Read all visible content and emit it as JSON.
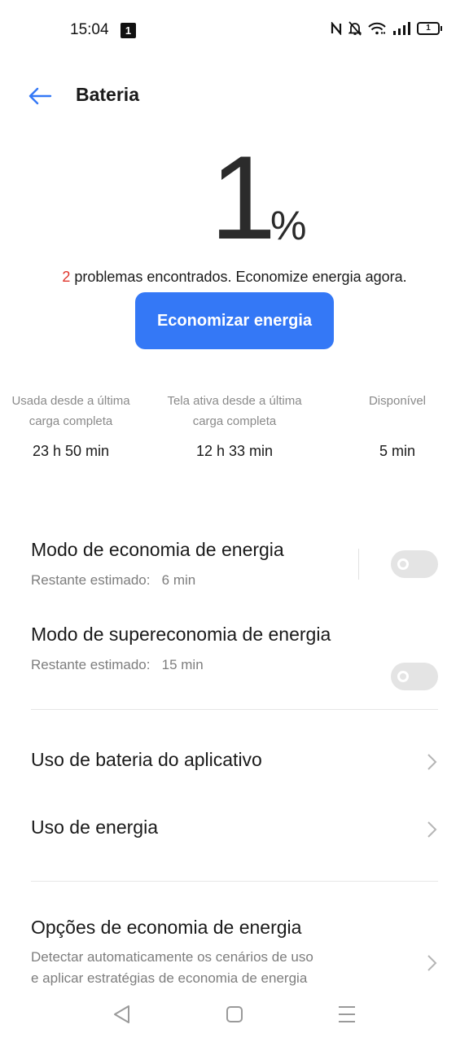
{
  "status_bar": {
    "time": "15:04",
    "notification_badge": "1",
    "icons": [
      "nfc-icon",
      "bell-off-icon",
      "wifi-icon",
      "signal-icon",
      "battery-icon"
    ],
    "battery_level": "1"
  },
  "header": {
    "title": "Bateria",
    "back_icon": "arrow-left-icon"
  },
  "battery": {
    "percent_value": "1",
    "percent_sign": "%"
  },
  "problems": {
    "count": "2",
    "text": " problemas encontrados. Economize energia agora."
  },
  "save_button": {
    "label": "Economizar energia"
  },
  "stats": [
    {
      "label_line1": "Usada desde a última",
      "label_line2": "carga completa",
      "value": "23 h 50 min"
    },
    {
      "label_line1": "Tela ativa desde a última",
      "label_line2": "carga completa",
      "value": "12 h 33 min"
    },
    {
      "label_line1": "Disponível",
      "label_line2": "",
      "value": "5 min"
    }
  ],
  "modes": [
    {
      "title": "Modo de economia de energia",
      "subtitle_label": "Restante estimado:",
      "subtitle_value": "6 min",
      "enabled": false
    },
    {
      "title": "Modo de supereconomia de energia",
      "subtitle_label": "Restante estimado:",
      "subtitle_value": "15 min",
      "enabled": false
    }
  ],
  "links": [
    {
      "title": "Uso de bateria do aplicativo"
    },
    {
      "title": "Uso de energia"
    }
  ],
  "options": {
    "title": "Opções de economia de energia",
    "description_line1": "Detectar automaticamente os cenários de uso",
    "description_line2": "e aplicar estratégias de economia de energia"
  },
  "nav_bar": {
    "icons": [
      "back-triangle-icon",
      "home-square-icon",
      "menu-lines-icon"
    ]
  },
  "colors": {
    "accent": "#3478f6",
    "warning": "#e0342b",
    "toggle_off": "#e4e4e4"
  }
}
